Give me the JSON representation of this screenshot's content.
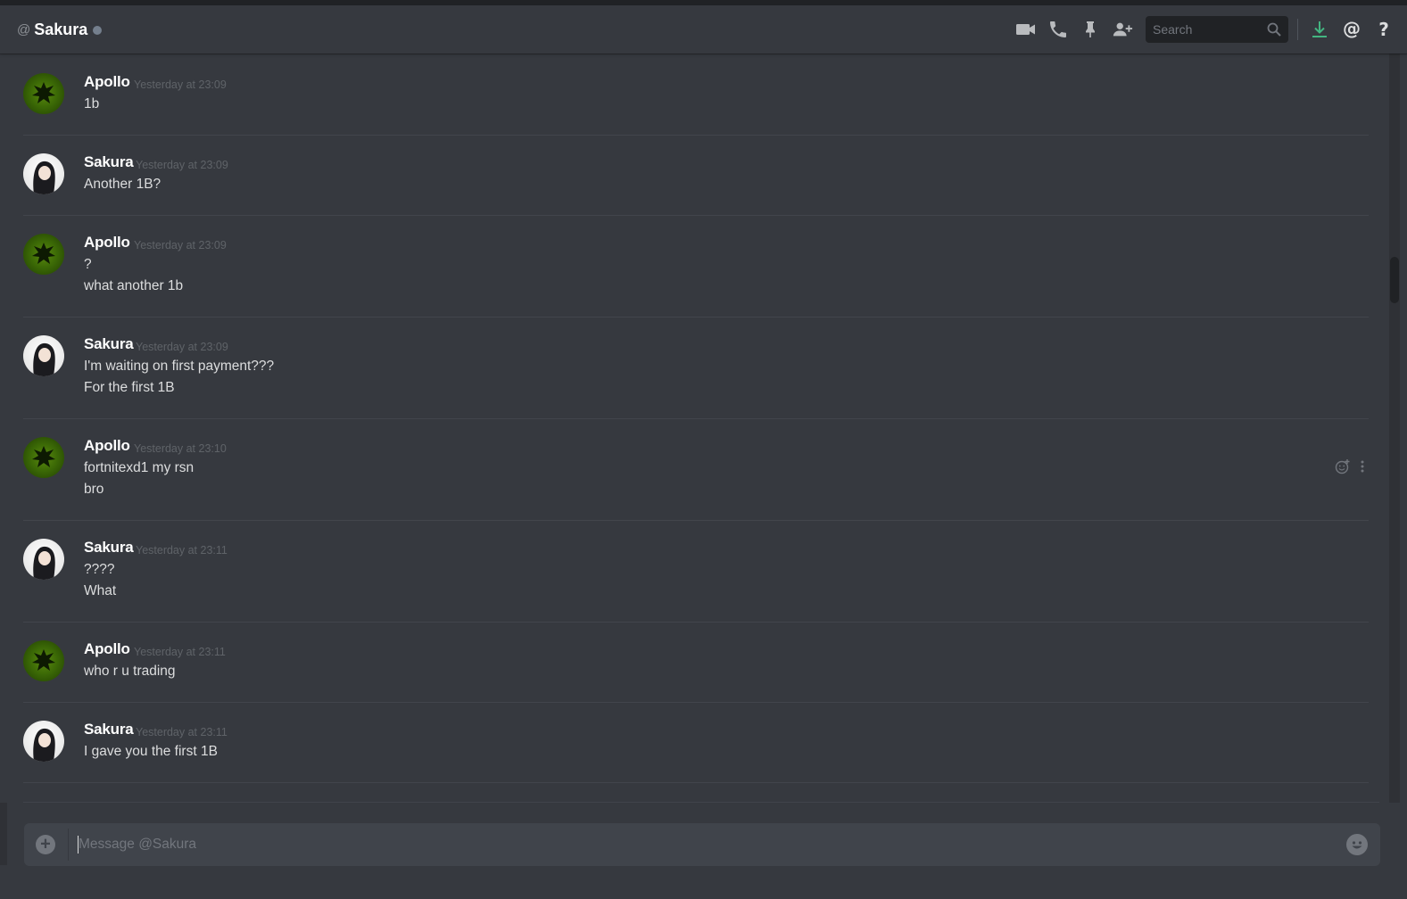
{
  "header": {
    "at_symbol": "@",
    "title": "Sakura",
    "search_placeholder": "Search",
    "icons": [
      "video-call-icon",
      "voice-call-icon",
      "pin-icon",
      "add-friend-icon",
      "search-icon",
      "download-icon",
      "mention-icon",
      "help-icon"
    ],
    "download_icon_color": "#43b581"
  },
  "messages": [
    {
      "author": "Apollo",
      "timestamp": "Yesterday at 23:09",
      "lines": [
        "1b"
      ]
    },
    {
      "author": "Sakura",
      "timestamp": "Yesterday at 23:09",
      "lines": [
        "Another 1B?"
      ]
    },
    {
      "author": "Apollo",
      "timestamp": "Yesterday at 23:09",
      "lines": [
        "?",
        "what another 1b"
      ]
    },
    {
      "author": "Sakura",
      "timestamp": "Yesterday at 23:09",
      "lines": [
        "I'm waiting on first payment???",
        "For the first 1B"
      ]
    },
    {
      "author": "Apollo",
      "timestamp": "Yesterday at 23:10",
      "lines": [
        "fortnitexd1 my rsn",
        "bro"
      ],
      "hovered": true
    },
    {
      "author": "Sakura",
      "timestamp": "Yesterday at 23:11",
      "lines": [
        "????",
        "What"
      ]
    },
    {
      "author": "Apollo",
      "timestamp": "Yesterday at 23:11",
      "lines": [
        "who r u trading"
      ]
    },
    {
      "author": "Sakura",
      "timestamp": "Yesterday at 23:11",
      "lines": [
        "I gave you the first 1B"
      ]
    }
  ],
  "composer": {
    "placeholder": "Message @Sakura",
    "upload_glyph": "+"
  }
}
